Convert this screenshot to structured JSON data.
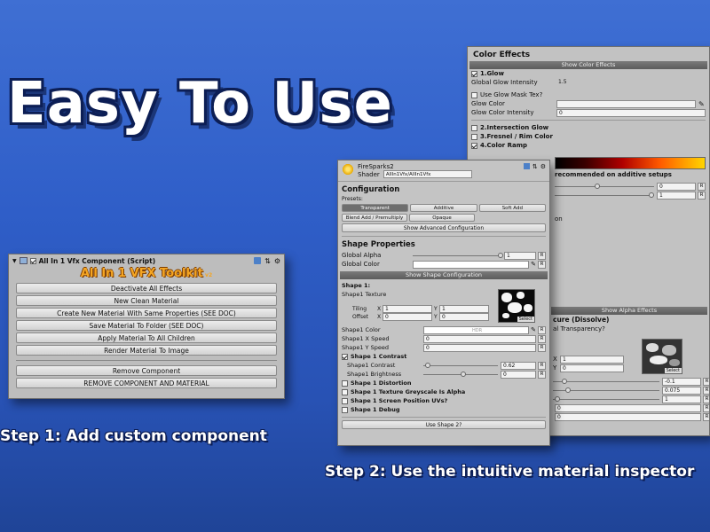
{
  "headline": "Easy To Use",
  "captions": {
    "step1": "Step 1: Add custom component",
    "step2": "Step 2: Use the intuitive material inspector"
  },
  "component_panel": {
    "title": "All In 1 Vfx Component (Script)",
    "logo": "All In 1 VFX Toolkit",
    "logo_version": "v2",
    "buttons": [
      "Deactivate All Effects",
      "New Clean Material",
      "Create New Material With Same Properties (SEE DOC)",
      "Save Material To Folder (SEE DOC)",
      "Apply Material To All Children",
      "Render Material To Image",
      "Remove Component",
      "REMOVE COMPONENT AND MATERIAL"
    ]
  },
  "color_panel": {
    "title": "Color Effects",
    "show_bar": "Show Color Effects",
    "glow_label": "1.Glow",
    "glow_intensity_label": "Global Glow Intensity",
    "glow_intensity_value": "1.5",
    "mask_label": "Use Glow Mask Tex?",
    "glow_color_label": "Glow Color",
    "glow_color_intensity_label": "Glow Color Intensity",
    "glow_color_intensity_value": "0",
    "intersection_label": "2.Intersection Glow",
    "fresnel_label": "3.Fresnel / Rim Color",
    "ramp_label": "4.Color Ramp",
    "ramp_note": "recommended on additive setups",
    "ramp_value1": "0",
    "ramp_value2": "1",
    "on_text": "on",
    "alpha_bar": "Show Alpha Effects",
    "dissolve_label": "cure (Dissolve)",
    "transparency_label": "al Transparency?",
    "tex_x": "1",
    "tex_y": "0",
    "select": "Select",
    "values": [
      "-0.1",
      "0.075",
      "1",
      "0",
      "0"
    ]
  },
  "material_panel": {
    "name": "FireSparks2",
    "shader_label": "Shader",
    "shader_value": "AllIn1Vfx/AllIn1Vfx",
    "configuration": "Configuration",
    "presets": "Presets:",
    "preset_buttons": [
      "Transparent",
      "Additive",
      "Soft Add",
      "Blend Add / Premultiply",
      "Opaque"
    ],
    "show_adv": "Show Advanced Configuration",
    "shape_props": "Shape Properties",
    "global_alpha_label": "Global Alpha",
    "global_alpha_value": "1",
    "global_color_label": "Global Color",
    "show_shape_cfg": "Show Shape Configuration",
    "shape1": "Shape 1:",
    "shape1_texture": "Shape1 Texture",
    "tiling": "Tiling",
    "offset": "Offset",
    "x": "X",
    "y": "Y",
    "tiling_x": "1",
    "tiling_y": "1",
    "offset_x": "0",
    "offset_y": "0",
    "select": "Select",
    "shape1_color": "Shape1 Color",
    "hdr": "HDR",
    "x_speed": "Shape1 X Speed",
    "x_speed_value": "0",
    "y_speed": "Shape1 Y Speed",
    "y_speed_value": "0",
    "contrast_toggle": "Shape 1 Contrast",
    "contrast_label": "Shape1 Contrast",
    "contrast_value": "0.62",
    "brightness_label": "Shape1 Brightness",
    "brightness_value": "0",
    "distortion": "Shape 1 Distortion",
    "greyscale": "Shape 1 Texture Greyscale Is Alpha",
    "screen_uv": "Shape 1 Screen Position UVs?",
    "debug": "Shape 1 Debug",
    "use_shape2": "Use Shape 2?"
  },
  "reset_label": "R",
  "colors": {
    "bg_top": "#3f6fd3",
    "bg_bottom": "#1f4497",
    "panel": "#c2c2c2",
    "bar": "#6a6a6a",
    "logo": "#f5a623"
  }
}
